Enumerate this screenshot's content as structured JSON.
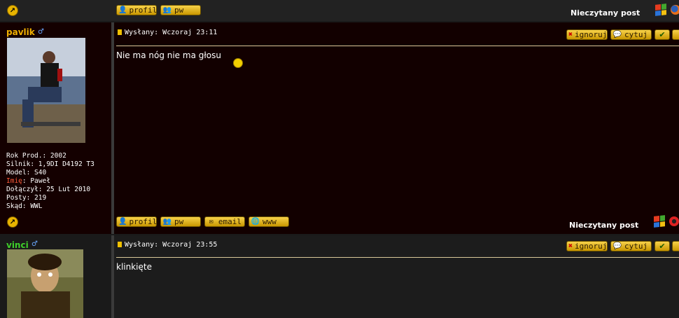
{
  "top_bar": {
    "profile_label": "profil",
    "pw_label": "pw",
    "unread_label": "Nieczytany post"
  },
  "posts": [
    {
      "username": "pavlik",
      "username_color": "#f0b000",
      "profile": {
        "rok_label": "Rok Prod.: 2002",
        "silnik_label": "Silnik: 1,9DI D4192 T3",
        "model_label": "Model: S40",
        "imie_key": "Imię",
        "imie_value": ": Paweł",
        "dolaczyl_label": "Dołączył: 25 Lut 2010",
        "posty_label": "Posty: 219",
        "skad_label": "Skąd: WWL"
      },
      "posted": "Wysłany: Wczoraj 23:11",
      "actions": {
        "ignore": "ignoruj",
        "quote": "cytuj"
      },
      "message": "Nie ma nóg nie ma głosu",
      "footer": {
        "profile_label": "profil",
        "pw_label": "pw",
        "email_label": "email",
        "www_label": "www",
        "unread_label": "Nieczytany post"
      }
    },
    {
      "username": "vinci",
      "username_color": "#3fcf2a",
      "posted": "Wysłany: Wczoraj 23:55",
      "actions": {
        "ignore": "ignoruj",
        "quote": "cytuj"
      },
      "message": "klinkięte"
    }
  ],
  "colors": {
    "post_background": "#120000",
    "bar_background": "#222222",
    "button_gold": "#f7d24a"
  }
}
